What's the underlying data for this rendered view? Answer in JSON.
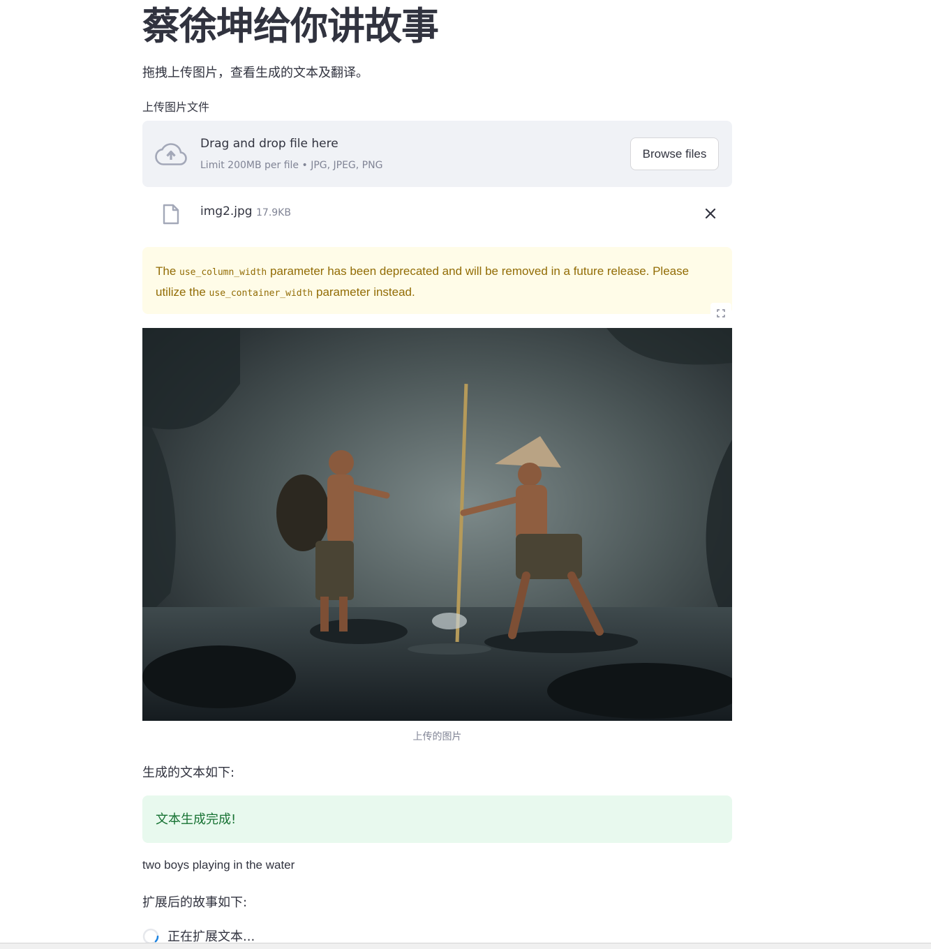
{
  "page": {
    "title": "蔡徐坤给你讲故事",
    "subtitle": "拖拽上传图片，查看生成的文本及翻译。"
  },
  "uploader": {
    "label": "上传图片文件",
    "drop_title": "Drag and drop file here",
    "drop_hint": "Limit 200MB per file • JPG, JPEG, PNG",
    "browse_label": "Browse files",
    "upload_icon": "cloud-upload-icon",
    "file": {
      "name": "img2.jpg",
      "size": "17.9KB",
      "icon": "file-icon",
      "remove_icon": "close-icon"
    }
  },
  "warning": {
    "part1": "The ",
    "code1": "use_column_width",
    "part2": " parameter has been deprecated and will be removed in a future release. Please utilize the ",
    "code2": "use_container_width",
    "part3": " parameter instead."
  },
  "image": {
    "caption": "上传的图片",
    "fullscreen_icon": "fullscreen-icon"
  },
  "generated": {
    "label": "生成的文本如下:",
    "status": "文本生成完成!",
    "text": "two boys playing in the water"
  },
  "expanded": {
    "label": "扩展后的故事如下:",
    "loading_text": "正在扩展文本..."
  },
  "colors": {
    "warning_text": "#926c05",
    "warning_bg": "#fffce8",
    "success_text": "#177233",
    "success_bg": "#e8f9ee",
    "dropzone_bg": "#f0f2f6"
  }
}
